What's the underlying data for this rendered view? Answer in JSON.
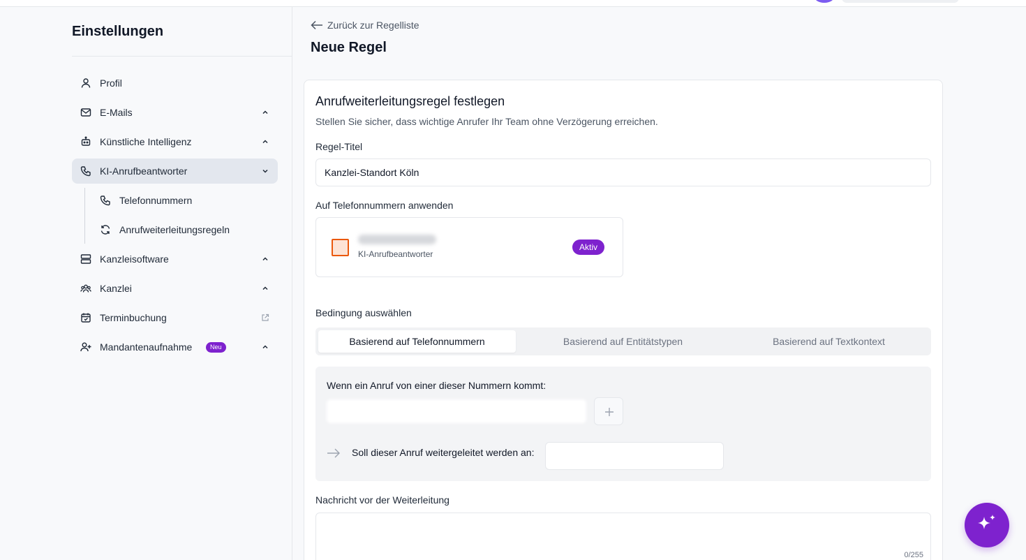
{
  "sidebar": {
    "title": "Einstellungen",
    "items": [
      {
        "label": "Profil"
      },
      {
        "label": "E-Mails"
      },
      {
        "label": "Künstliche Intelligenz"
      },
      {
        "label": "KI-Anrufbeantworter"
      },
      {
        "label": "Kanzleisoftware"
      },
      {
        "label": "Kanzlei"
      },
      {
        "label": "Terminbuchung"
      },
      {
        "label": "Mandantenaufnahme",
        "badge": "Neu"
      }
    ],
    "subitems": [
      {
        "label": "Telefonnummern"
      },
      {
        "label": "Anrufweiterleitungsregeln"
      }
    ]
  },
  "header": {
    "back_label": "Zurück zur Regelliste",
    "page_title": "Neue Regel"
  },
  "form": {
    "card_title": "Anrufweiterleitungsregel festlegen",
    "card_subtitle": "Stellen Sie sicher, dass wichtige Anrufer Ihr Team ohne Verzögerung erreichen.",
    "rule_title_label": "Regel-Titel",
    "rule_title_value": "Kanzlei-Standort Köln",
    "apply_label": "Auf Telefonnummern anwenden",
    "phone_card": {
      "sub": "KI-Anrufbeantworter",
      "status": "Aktiv"
    },
    "condition_label": "Bedingung auswählen",
    "tabs": [
      {
        "label": "Basierend auf Telefonnummern"
      },
      {
        "label": "Basierend auf Entitätstypen"
      },
      {
        "label": "Basierend auf Textkontext"
      }
    ],
    "when_label": "Wenn ein Anruf von einer dieser Nummern kommt:",
    "forward_label": "Soll dieser Anruf weitergeleitet werden an:",
    "message_label": "Nachricht vor der Weiterleitung",
    "message_count": "0/255"
  },
  "colors": {
    "accent": "#7e22ce",
    "checkbox_border": "#ea580c"
  }
}
